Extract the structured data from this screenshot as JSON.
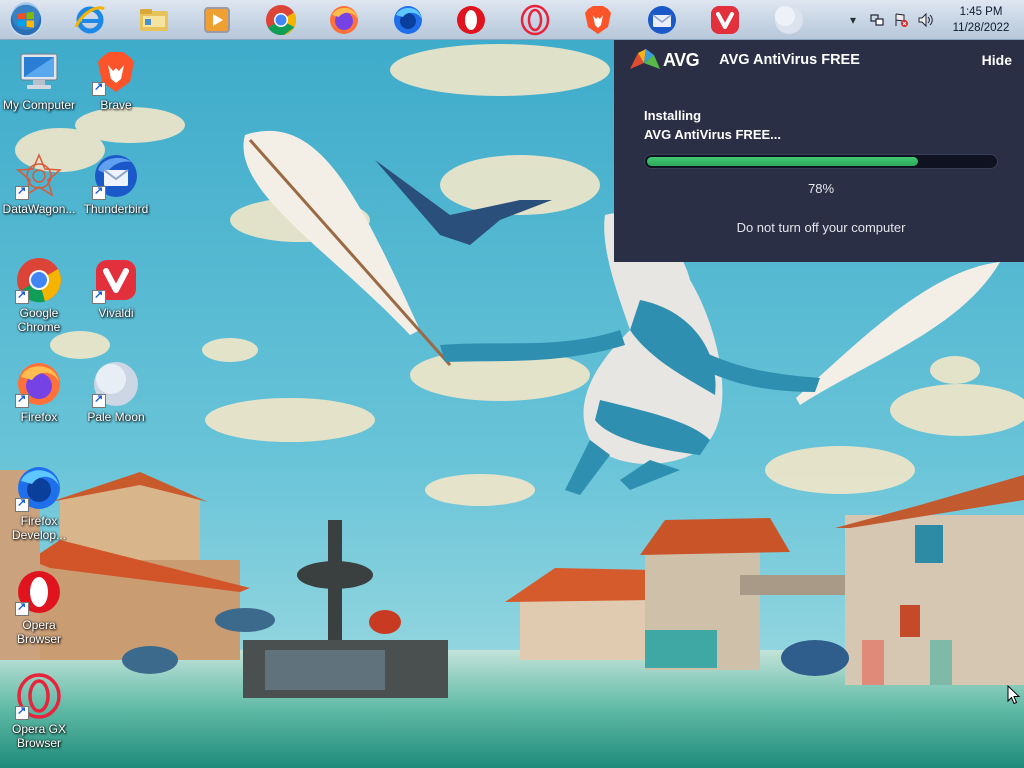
{
  "taskbar": {
    "start_icon": "windows-orb-icon",
    "pinned": [
      {
        "name": "internet-explorer",
        "icon": "internet-explorer-icon"
      },
      {
        "name": "file-explorer",
        "icon": "folder-icon"
      },
      {
        "name": "media-player",
        "icon": "media-player-icon"
      },
      {
        "name": "google-chrome",
        "icon": "chrome-icon"
      },
      {
        "name": "firefox",
        "icon": "firefox-icon"
      },
      {
        "name": "firefox-developer",
        "icon": "firefox-developer-icon"
      },
      {
        "name": "opera",
        "icon": "opera-icon"
      },
      {
        "name": "opera-gx",
        "icon": "opera-gx-icon"
      },
      {
        "name": "brave",
        "icon": "brave-icon"
      },
      {
        "name": "thunderbird",
        "icon": "thunderbird-icon"
      },
      {
        "name": "vivaldi",
        "icon": "vivaldi-icon"
      },
      {
        "name": "pale-moon",
        "icon": "pale-moon-icon"
      }
    ],
    "clock": {
      "time": "1:45 PM",
      "date": "11/28/2022"
    }
  },
  "desktop": {
    "icons": [
      {
        "label": "My Computer",
        "icon": "computer-icon"
      },
      {
        "label": "Brave",
        "icon": "brave-icon"
      },
      {
        "label": "DataWagon...",
        "icon": "datawagon-icon"
      },
      {
        "label": "Thunderbird",
        "icon": "thunderbird-icon"
      },
      {
        "label": "Google Chrome",
        "icon": "chrome-icon"
      },
      {
        "label": "Vivaldi",
        "icon": "vivaldi-icon"
      },
      {
        "label": "Firefox",
        "icon": "firefox-icon"
      },
      {
        "label": "Pale Moon",
        "icon": "pale-moon-icon"
      },
      {
        "label": "Firefox Develop...",
        "icon": "firefox-developer-icon"
      },
      {
        "label": "Opera Browser",
        "icon": "opera-icon"
      },
      {
        "label": "Opera GX Browser",
        "icon": "opera-gx-icon"
      }
    ]
  },
  "avg": {
    "logo_text": "AVG",
    "title": "AVG AntiVirus FREE",
    "hide_label": "Hide",
    "status_line1": "Installing",
    "status_line2": "AVG AntiVirus FREE...",
    "progress_percent": 78,
    "progress_label": "78%",
    "note": "Do not turn off your computer",
    "colors": {
      "panel_bg": "#2b2f45",
      "progress_fill": "#34b864",
      "progress_track": "#0f1220"
    }
  }
}
